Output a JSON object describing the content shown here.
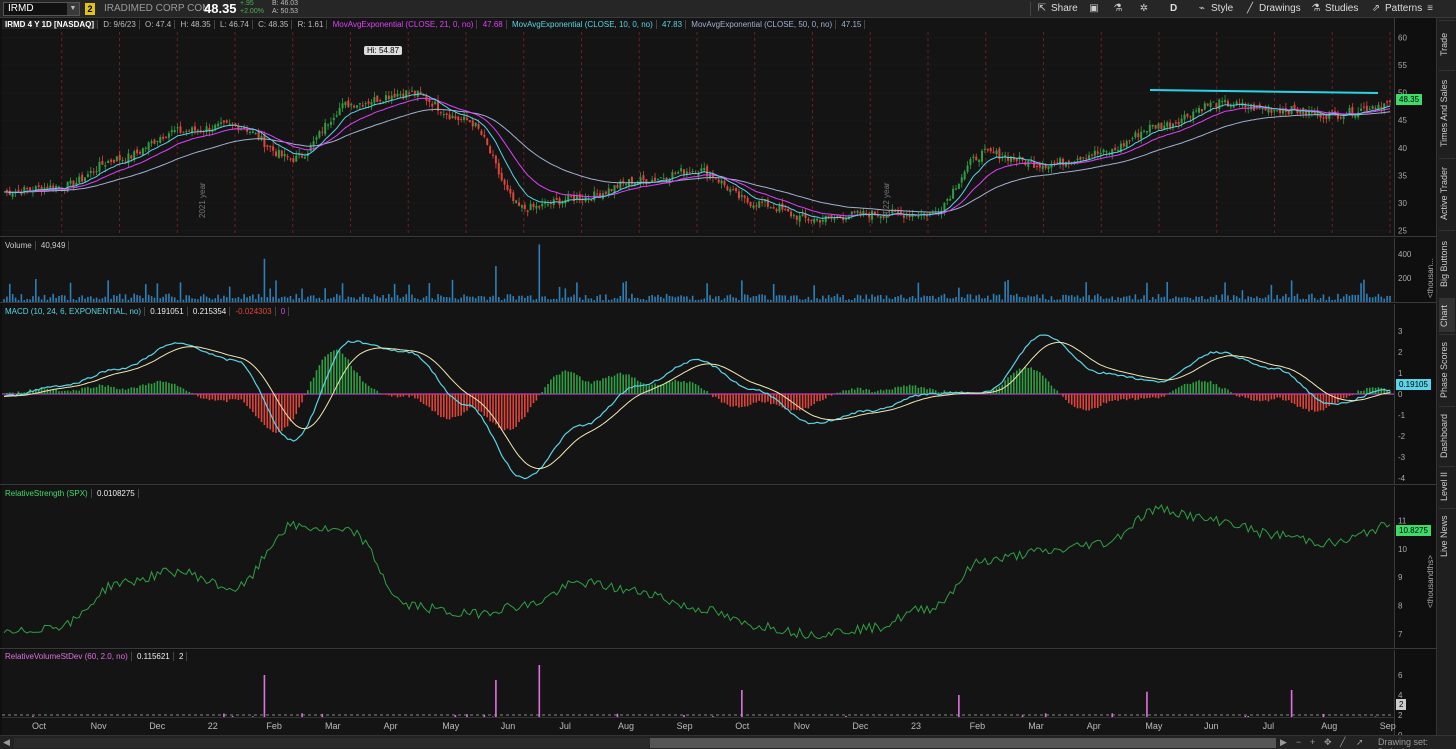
{
  "header": {
    "symbol": "IRMD",
    "link_badge": "2",
    "company": "IRADIMED CORP COM",
    "last": "48.35",
    "change": "+.95",
    "change_pct": "+2.00%",
    "bid": "B: 46.03",
    "ask": "A: 50.53"
  },
  "toolbar": {
    "share": "Share",
    "style": "Style",
    "period": "D",
    "drawings": "Drawings",
    "studies": "Studies",
    "patterns": "Patterns"
  },
  "price_pane": {
    "title": "IRMD 4 Y 1D [NASDAQ]",
    "ohlc": [
      "D: 9/6/23",
      "O: 47.4",
      "H: 48.35",
      "L: 46.74",
      "C: 48.35",
      "R: 1.61"
    ],
    "ma21_label": "MovAvgExponential (CLOSE, 21, 0, no)",
    "ma21_value": "47.68",
    "ma10_label": "MovAvgExponential (CLOSE, 10, 0, no)",
    "ma10_value": "47.83",
    "ma50_label": "MovAvgExponential (CLOSE, 50, 0, no)",
    "ma50_value": "47.15",
    "hi_bubble": "Hi: 54.87",
    "last_tag": "48.35",
    "axis": [
      "60",
      "55",
      "50",
      "45",
      "40",
      "35",
      "30",
      "25"
    ],
    "year_labels": [
      "2021 year",
      "2022 year"
    ],
    "colors": {
      "ma21": "#e040fb",
      "ma10": "#5ad4e6",
      "ma50": "#9fb0d0",
      "up": "#2ea043",
      "down": "#e0453a",
      "resistance": "#29d4e8"
    }
  },
  "volume_pane": {
    "label": "Volume",
    "value": "40,949",
    "axis": [
      "400",
      "200"
    ],
    "unit": "<thousan..."
  },
  "macd_pane": {
    "label": "MACD (10, 24, 6, EXPONENTIAL, no)",
    "v1": "0.191051",
    "v2": "0.215354",
    "v3": "-0.024303",
    "v4": "0",
    "axis": [
      "3",
      "2",
      "1",
      "0",
      "-1",
      "-2",
      "-3",
      "-4"
    ],
    "tag": "0.19105"
  },
  "rs_pane": {
    "label": "RelativeStrength (SPX)",
    "value": "0.0108275",
    "axis": [
      "11",
      "10",
      "9",
      "8",
      "7"
    ],
    "tag": "10.8275",
    "unit": "<thousandths>"
  },
  "rv_pane": {
    "label": "RelativeVolumeStDev (60, 2.0, no)",
    "v1": "0.115621",
    "v2": "2",
    "axis": [
      "6",
      "4",
      "2",
      "0"
    ],
    "tag": "2"
  },
  "x_axis": [
    "Oct",
    "Nov",
    "Dec",
    "22",
    "Feb",
    "Mar",
    "Apr",
    "May",
    "Jun",
    "Jul",
    "Aug",
    "Sep",
    "Oct",
    "Nov",
    "Dec",
    "23",
    "Feb",
    "Mar",
    "Apr",
    "May",
    "Jun",
    "Jul",
    "Aug",
    "Sep"
  ],
  "right_tabs": [
    "Trade",
    "Times And Sales",
    "Active Trader",
    "Big Buttons",
    "Chart",
    "Phase Scores",
    "Dashboard",
    "Level II",
    "Live News"
  ],
  "footer": {
    "drawing_set": "Drawing set: Default"
  },
  "chart_data": {
    "type": "line",
    "x": [
      "2021-09",
      "2021-10",
      "2021-11",
      "2021-12",
      "2022-01",
      "2022-02",
      "2022-03",
      "2022-04",
      "2022-05",
      "2022-06",
      "2022-07",
      "2022-08",
      "2022-09",
      "2022-10",
      "2022-11",
      "2022-12",
      "2023-01",
      "2023-02",
      "2023-03",
      "2023-04",
      "2023-05",
      "2023-06",
      "2023-07",
      "2023-08",
      "2023-09"
    ],
    "series": [
      {
        "values": [
          32,
          33,
          38,
          43,
          44,
          38,
          48,
          50,
          45,
          29,
          31,
          34,
          36,
          30,
          27,
          28,
          28,
          39,
          37,
          39,
          44,
          48,
          47,
          46,
          48
        ]
      },
      {
        "name": "RelativeStrength (SPX)",
        "values": [
          7.0,
          7.3,
          8.8,
          9.2,
          8.6,
          10.8,
          10.6,
          8.0,
          7.7,
          8.0,
          8.8,
          8.5,
          7.9,
          7.3,
          7.0,
          7.2,
          7.9,
          9.6,
          9.9,
          10.2,
          11.4,
          11.0,
          10.5,
          10.2,
          10.8
        ]
      }
    ],
    "ylim": [
      24,
      61
    ],
    "resistance": 50.2
  },
  "macd_data": {
    "macd": [
      -0.1,
      0.4,
      1.2,
      2.4,
      1.6,
      -2.2,
      2.5,
      2.0,
      -0.5,
      -4.0,
      -1.5,
      0.4,
      1.6,
      0.2,
      -1.4,
      -0.8,
      0.0,
      0.1,
      2.8,
      1.0,
      0.6,
      2.0,
      1.2,
      -0.5,
      0.2
    ]
  }
}
